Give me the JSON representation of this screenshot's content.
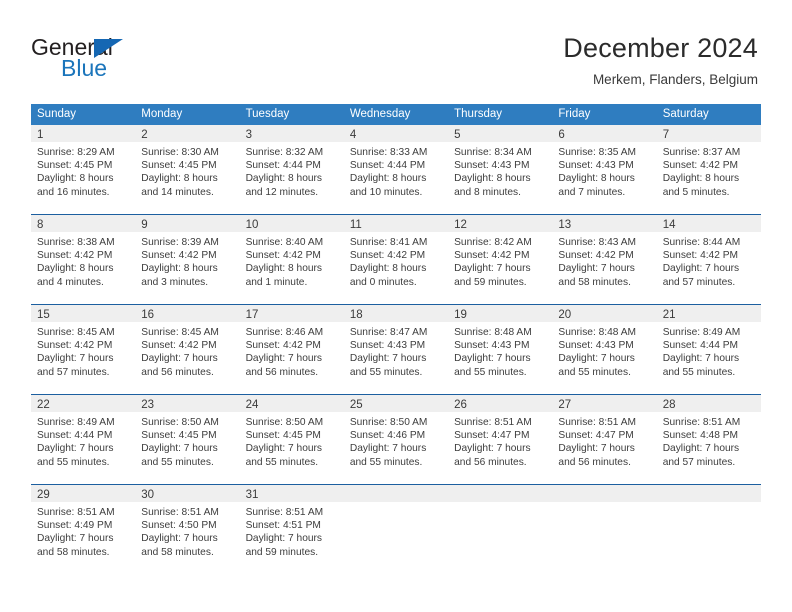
{
  "brand": {
    "word_top": "General",
    "word_bottom": "Blue",
    "triangle_color": "#1567b3",
    "blue_color": "#1b75bb"
  },
  "header": {
    "title": "December 2024",
    "subtitle": "Merkem, Flanders, Belgium"
  },
  "colors": {
    "header_blue": "#2f7dc0",
    "week_rule": "#1c5fa0",
    "day_band": "#efefef",
    "text": "#3d3d3d"
  },
  "weekdays": [
    "Sunday",
    "Monday",
    "Tuesday",
    "Wednesday",
    "Thursday",
    "Friday",
    "Saturday"
  ],
  "weeks": [
    [
      {
        "day": "1",
        "sunrise": "Sunrise: 8:29 AM",
        "sunset": "Sunset: 4:45 PM",
        "daylight1": "Daylight: 8 hours",
        "daylight2": "and 16 minutes."
      },
      {
        "day": "2",
        "sunrise": "Sunrise: 8:30 AM",
        "sunset": "Sunset: 4:45 PM",
        "daylight1": "Daylight: 8 hours",
        "daylight2": "and 14 minutes."
      },
      {
        "day": "3",
        "sunrise": "Sunrise: 8:32 AM",
        "sunset": "Sunset: 4:44 PM",
        "daylight1": "Daylight: 8 hours",
        "daylight2": "and 12 minutes."
      },
      {
        "day": "4",
        "sunrise": "Sunrise: 8:33 AM",
        "sunset": "Sunset: 4:44 PM",
        "daylight1": "Daylight: 8 hours",
        "daylight2": "and 10 minutes."
      },
      {
        "day": "5",
        "sunrise": "Sunrise: 8:34 AM",
        "sunset": "Sunset: 4:43 PM",
        "daylight1": "Daylight: 8 hours",
        "daylight2": "and 8 minutes."
      },
      {
        "day": "6",
        "sunrise": "Sunrise: 8:35 AM",
        "sunset": "Sunset: 4:43 PM",
        "daylight1": "Daylight: 8 hours",
        "daylight2": "and 7 minutes."
      },
      {
        "day": "7",
        "sunrise": "Sunrise: 8:37 AM",
        "sunset": "Sunset: 4:42 PM",
        "daylight1": "Daylight: 8 hours",
        "daylight2": "and 5 minutes."
      }
    ],
    [
      {
        "day": "8",
        "sunrise": "Sunrise: 8:38 AM",
        "sunset": "Sunset: 4:42 PM",
        "daylight1": "Daylight: 8 hours",
        "daylight2": "and 4 minutes."
      },
      {
        "day": "9",
        "sunrise": "Sunrise: 8:39 AM",
        "sunset": "Sunset: 4:42 PM",
        "daylight1": "Daylight: 8 hours",
        "daylight2": "and 3 minutes."
      },
      {
        "day": "10",
        "sunrise": "Sunrise: 8:40 AM",
        "sunset": "Sunset: 4:42 PM",
        "daylight1": "Daylight: 8 hours",
        "daylight2": "and 1 minute."
      },
      {
        "day": "11",
        "sunrise": "Sunrise: 8:41 AM",
        "sunset": "Sunset: 4:42 PM",
        "daylight1": "Daylight: 8 hours",
        "daylight2": "and 0 minutes."
      },
      {
        "day": "12",
        "sunrise": "Sunrise: 8:42 AM",
        "sunset": "Sunset: 4:42 PM",
        "daylight1": "Daylight: 7 hours",
        "daylight2": "and 59 minutes."
      },
      {
        "day": "13",
        "sunrise": "Sunrise: 8:43 AM",
        "sunset": "Sunset: 4:42 PM",
        "daylight1": "Daylight: 7 hours",
        "daylight2": "and 58 minutes."
      },
      {
        "day": "14",
        "sunrise": "Sunrise: 8:44 AM",
        "sunset": "Sunset: 4:42 PM",
        "daylight1": "Daylight: 7 hours",
        "daylight2": "and 57 minutes."
      }
    ],
    [
      {
        "day": "15",
        "sunrise": "Sunrise: 8:45 AM",
        "sunset": "Sunset: 4:42 PM",
        "daylight1": "Daylight: 7 hours",
        "daylight2": "and 57 minutes."
      },
      {
        "day": "16",
        "sunrise": "Sunrise: 8:45 AM",
        "sunset": "Sunset: 4:42 PM",
        "daylight1": "Daylight: 7 hours",
        "daylight2": "and 56 minutes."
      },
      {
        "day": "17",
        "sunrise": "Sunrise: 8:46 AM",
        "sunset": "Sunset: 4:42 PM",
        "daylight1": "Daylight: 7 hours",
        "daylight2": "and 56 minutes."
      },
      {
        "day": "18",
        "sunrise": "Sunrise: 8:47 AM",
        "sunset": "Sunset: 4:43 PM",
        "daylight1": "Daylight: 7 hours",
        "daylight2": "and 55 minutes."
      },
      {
        "day": "19",
        "sunrise": "Sunrise: 8:48 AM",
        "sunset": "Sunset: 4:43 PM",
        "daylight1": "Daylight: 7 hours",
        "daylight2": "and 55 minutes."
      },
      {
        "day": "20",
        "sunrise": "Sunrise: 8:48 AM",
        "sunset": "Sunset: 4:43 PM",
        "daylight1": "Daylight: 7 hours",
        "daylight2": "and 55 minutes."
      },
      {
        "day": "21",
        "sunrise": "Sunrise: 8:49 AM",
        "sunset": "Sunset: 4:44 PM",
        "daylight1": "Daylight: 7 hours",
        "daylight2": "and 55 minutes."
      }
    ],
    [
      {
        "day": "22",
        "sunrise": "Sunrise: 8:49 AM",
        "sunset": "Sunset: 4:44 PM",
        "daylight1": "Daylight: 7 hours",
        "daylight2": "and 55 minutes."
      },
      {
        "day": "23",
        "sunrise": "Sunrise: 8:50 AM",
        "sunset": "Sunset: 4:45 PM",
        "daylight1": "Daylight: 7 hours",
        "daylight2": "and 55 minutes."
      },
      {
        "day": "24",
        "sunrise": "Sunrise: 8:50 AM",
        "sunset": "Sunset: 4:45 PM",
        "daylight1": "Daylight: 7 hours",
        "daylight2": "and 55 minutes."
      },
      {
        "day": "25",
        "sunrise": "Sunrise: 8:50 AM",
        "sunset": "Sunset: 4:46 PM",
        "daylight1": "Daylight: 7 hours",
        "daylight2": "and 55 minutes."
      },
      {
        "day": "26",
        "sunrise": "Sunrise: 8:51 AM",
        "sunset": "Sunset: 4:47 PM",
        "daylight1": "Daylight: 7 hours",
        "daylight2": "and 56 minutes."
      },
      {
        "day": "27",
        "sunrise": "Sunrise: 8:51 AM",
        "sunset": "Sunset: 4:47 PM",
        "daylight1": "Daylight: 7 hours",
        "daylight2": "and 56 minutes."
      },
      {
        "day": "28",
        "sunrise": "Sunrise: 8:51 AM",
        "sunset": "Sunset: 4:48 PM",
        "daylight1": "Daylight: 7 hours",
        "daylight2": "and 57 minutes."
      }
    ],
    [
      {
        "day": "29",
        "sunrise": "Sunrise: 8:51 AM",
        "sunset": "Sunset: 4:49 PM",
        "daylight1": "Daylight: 7 hours",
        "daylight2": "and 58 minutes."
      },
      {
        "day": "30",
        "sunrise": "Sunrise: 8:51 AM",
        "sunset": "Sunset: 4:50 PM",
        "daylight1": "Daylight: 7 hours",
        "daylight2": "and 58 minutes."
      },
      {
        "day": "31",
        "sunrise": "Sunrise: 8:51 AM",
        "sunset": "Sunset: 4:51 PM",
        "daylight1": "Daylight: 7 hours",
        "daylight2": "and 59 minutes."
      },
      {
        "day": "",
        "sunrise": "",
        "sunset": "",
        "daylight1": "",
        "daylight2": ""
      },
      {
        "day": "",
        "sunrise": "",
        "sunset": "",
        "daylight1": "",
        "daylight2": ""
      },
      {
        "day": "",
        "sunrise": "",
        "sunset": "",
        "daylight1": "",
        "daylight2": ""
      },
      {
        "day": "",
        "sunrise": "",
        "sunset": "",
        "daylight1": "",
        "daylight2": ""
      }
    ]
  ]
}
